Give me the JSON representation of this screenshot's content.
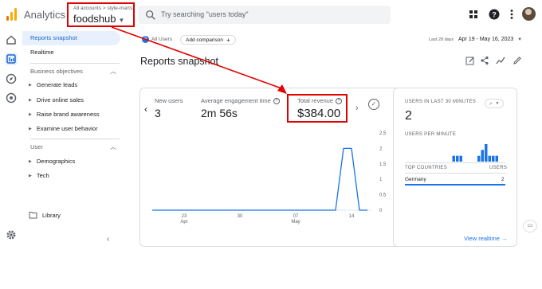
{
  "header": {
    "app_name": "Analytics",
    "account_crumb": "All accounts > style-marts",
    "account_name": "foodshub",
    "search_placeholder": "Try searching \"users today\""
  },
  "nav": {
    "reports_snapshot": "Reports snapshot",
    "realtime": "Realtime",
    "section_business": "Business objectives",
    "business_items": [
      "Generate leads",
      "Drive online sales",
      "Raise brand awareness",
      "Examine user behavior"
    ],
    "section_user": "User",
    "user_items": [
      "Demographics",
      "Tech"
    ],
    "library": "Library"
  },
  "toolbar": {
    "all_users_badge": "A",
    "all_users_label": "All Users",
    "add_comparison": "Add comparison",
    "date_label": "Last 28 days",
    "date_value": "Apr 19 - May 16, 2023"
  },
  "page_title": "Reports snapshot",
  "metrics": [
    {
      "label": "New users",
      "value": "3"
    },
    {
      "label": "Average engagement time",
      "value": "2m 56s"
    },
    {
      "label": "Total revenue",
      "value": "$384.00"
    }
  ],
  "chart_data": {
    "type": "line",
    "x_ticks": [
      {
        "day": "23",
        "month": "Apr"
      },
      {
        "day": "30",
        "month": ""
      },
      {
        "day": "07",
        "month": "May"
      },
      {
        "day": "14",
        "month": ""
      }
    ],
    "y_ticks": [
      "2.5",
      "2",
      "1.5",
      "1",
      "0.5",
      "0"
    ],
    "ylim": [
      0,
      2.5
    ],
    "series": [
      {
        "color": "#1a73e8",
        "x": [
          "Apr 19",
          "Apr 20",
          "Apr 21",
          "Apr 22",
          "Apr 23",
          "Apr 24",
          "Apr 25",
          "Apr 26",
          "Apr 27",
          "Apr 28",
          "Apr 29",
          "Apr 30",
          "May 1",
          "May 2",
          "May 3",
          "May 4",
          "May 5",
          "May 6",
          "May 7",
          "May 8",
          "May 9",
          "May 10",
          "May 11",
          "May 12",
          "May 13",
          "May 14",
          "May 15",
          "May 16"
        ],
        "values": [
          0,
          0,
          0,
          0,
          0,
          0,
          0,
          0,
          0,
          0,
          0,
          0,
          0,
          0,
          0,
          0,
          0,
          0,
          0,
          0,
          0,
          0,
          0,
          0,
          2,
          2,
          0,
          0
        ]
      }
    ]
  },
  "realtime": {
    "heading": "USERS IN LAST 30 MINUTES",
    "count": "2",
    "per_minute": "USERS PER MINUTE",
    "bars": [
      0,
      0,
      0,
      0,
      0,
      0,
      0,
      0,
      0,
      0,
      0,
      0,
      0,
      0,
      1,
      1,
      1,
      0,
      0,
      0,
      0,
      1,
      2,
      3,
      1,
      1,
      1,
      0,
      0,
      0
    ],
    "col_country": "TOP COUNTRIES",
    "col_users": "USERS",
    "rows": [
      {
        "country": "Germany",
        "users": "2"
      }
    ],
    "view_link": "View realtime"
  },
  "colors": {
    "accent": "#1a73e8",
    "annotation_red": "#e00000"
  }
}
